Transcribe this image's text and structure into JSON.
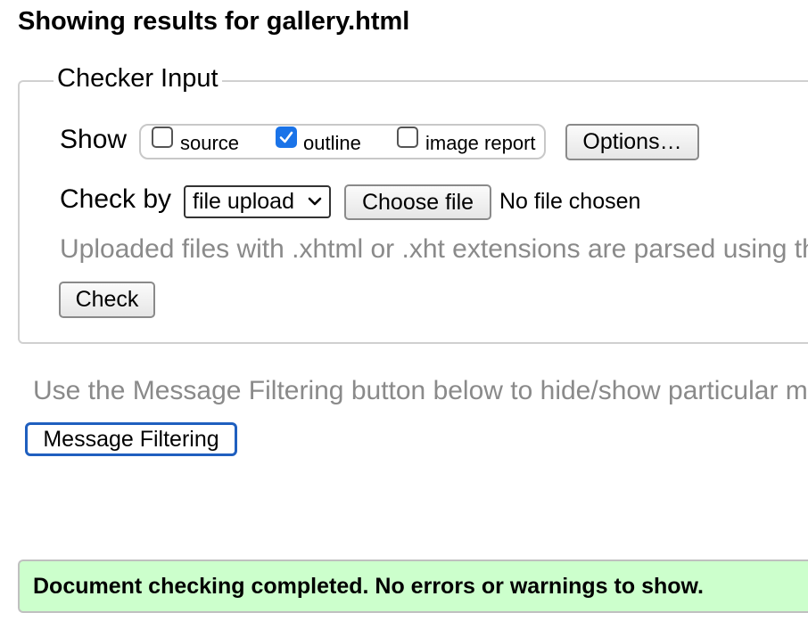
{
  "page": {
    "title": "Showing results for gallery.html"
  },
  "checker": {
    "legend": "Checker Input",
    "show_label": "Show",
    "show_options": [
      {
        "label": "source",
        "checked": false
      },
      {
        "label": "outline",
        "checked": true
      },
      {
        "label": "image report",
        "checked": false
      }
    ],
    "options_button": "Options…",
    "check_by_label": "Check by",
    "check_by_selected": "file upload",
    "choose_file_button": "Choose file",
    "no_file_text": "No file chosen",
    "upload_note": "Uploaded files with .xhtml or .xht extensions are parsed using the XML parser.",
    "check_button": "Check"
  },
  "filtering": {
    "note": "Use the Message Filtering button below to hide/show particular messages, and to see total counts of errors and warnings.",
    "button": "Message Filtering"
  },
  "result": {
    "message": "Document checking completed. No errors or warnings to show."
  },
  "colors": {
    "success_bg": "#ccffcc",
    "checkbox_accent": "#1a73e8",
    "focus_border": "#1f5fbf",
    "muted_text": "#8a8a8a"
  }
}
